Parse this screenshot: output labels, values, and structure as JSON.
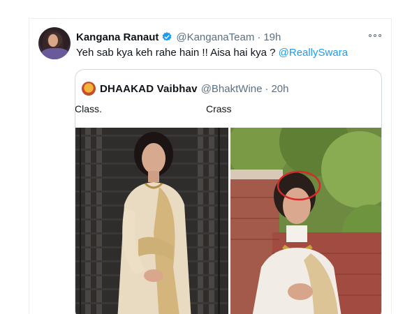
{
  "tweet": {
    "display_name": "Kangana Ranaut",
    "handle": "@KanganaTeam",
    "separator": "·",
    "time": "19h",
    "text_before_mention": "Yeh sab kya keh rahe hain !! Aisa hai kya ? ",
    "mention": "@ReallySwara"
  },
  "quoted_tweet": {
    "display_name": "DHAAKAD Vaibhav",
    "handle": "@BhaktWine",
    "separator": "·",
    "time": "20h",
    "caption_left": "Class.",
    "caption_right": "Crass"
  },
  "icons": {
    "verified": "verified-badge-icon",
    "more": "more-options-icon"
  },
  "colors": {
    "link": "#1d9bf0",
    "verified": "#1d9bf0",
    "secondary_text": "#5b7083",
    "annotation_circle": "#d62a2a"
  }
}
